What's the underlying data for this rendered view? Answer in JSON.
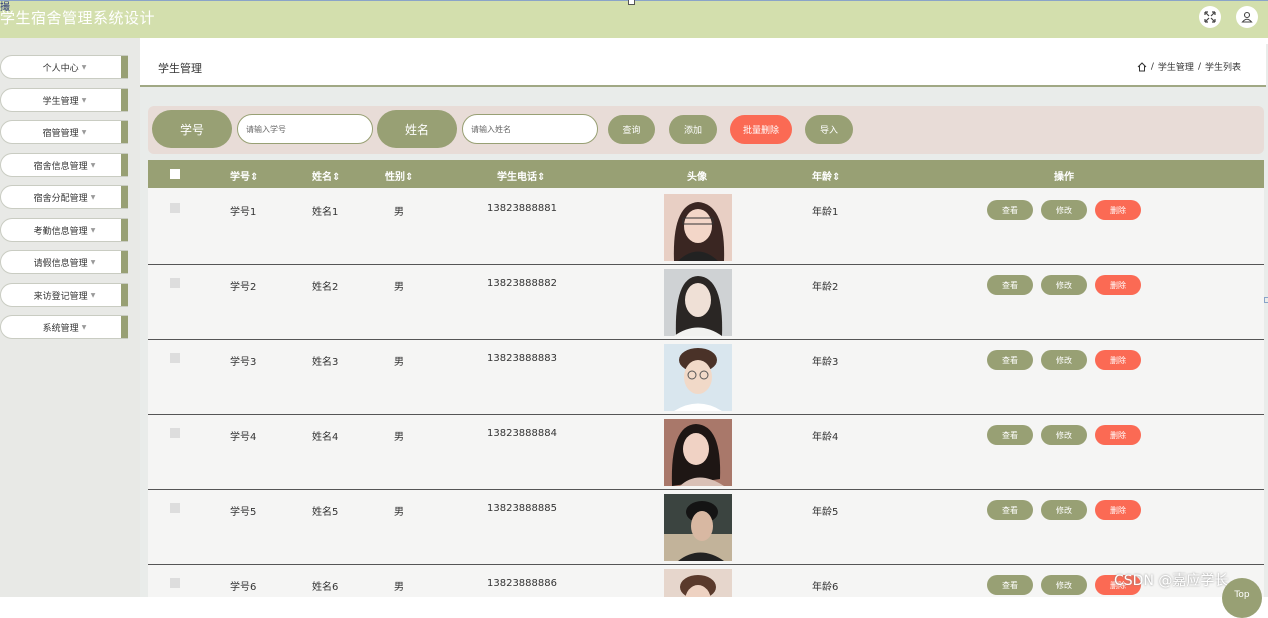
{
  "header": {
    "title": "学生宿舍管理系统设计",
    "corner_mark": "撮"
  },
  "sidebar": {
    "items": [
      {
        "label": "个人中心"
      },
      {
        "label": "学生管理"
      },
      {
        "label": "宿管管理"
      },
      {
        "label": "宿舍信息管理"
      },
      {
        "label": "宿舍分配管理"
      },
      {
        "label": "考勤信息管理"
      },
      {
        "label": "请假信息管理"
      },
      {
        "label": "来访登记管理"
      },
      {
        "label": "系统管理"
      }
    ]
  },
  "page": {
    "title": "学生管理",
    "breadcrumb": [
      "学生管理",
      "学生列表"
    ]
  },
  "search": {
    "student_no_label": "学号",
    "student_no_placeholder": "请输入学号",
    "name_label": "姓名",
    "name_placeholder": "请输入姓名",
    "query": "查询",
    "add": "添加",
    "batch_delete": "批量删除",
    "import": "导入"
  },
  "table": {
    "headers": [
      "学号",
      "姓名",
      "性别",
      "学生电话",
      "头像",
      "年龄",
      "操作"
    ],
    "rows": [
      {
        "no": "学号1",
        "name": "姓名1",
        "gender": "男",
        "phone": "13823888881",
        "age": "年龄1"
      },
      {
        "no": "学号2",
        "name": "姓名2",
        "gender": "男",
        "phone": "13823888882",
        "age": "年龄2"
      },
      {
        "no": "学号3",
        "name": "姓名3",
        "gender": "男",
        "phone": "13823888883",
        "age": "年龄3"
      },
      {
        "no": "学号4",
        "name": "姓名4",
        "gender": "男",
        "phone": "13823888884",
        "age": "年龄4"
      },
      {
        "no": "学号5",
        "name": "姓名5",
        "gender": "男",
        "phone": "13823888885",
        "age": "年龄5"
      },
      {
        "no": "学号6",
        "name": "姓名6",
        "gender": "男",
        "phone": "13823888886",
        "age": "年龄6"
      }
    ],
    "actions": {
      "view": "查看",
      "edit": "修改",
      "delete": "删除"
    }
  },
  "watermark": "CSDN @嘉应学长",
  "top_button": "Top",
  "colors": {
    "header_bg": "#d3dfad",
    "accent": "#98a074",
    "danger": "#fb6a54",
    "search_bg": "#e8dcd7"
  }
}
